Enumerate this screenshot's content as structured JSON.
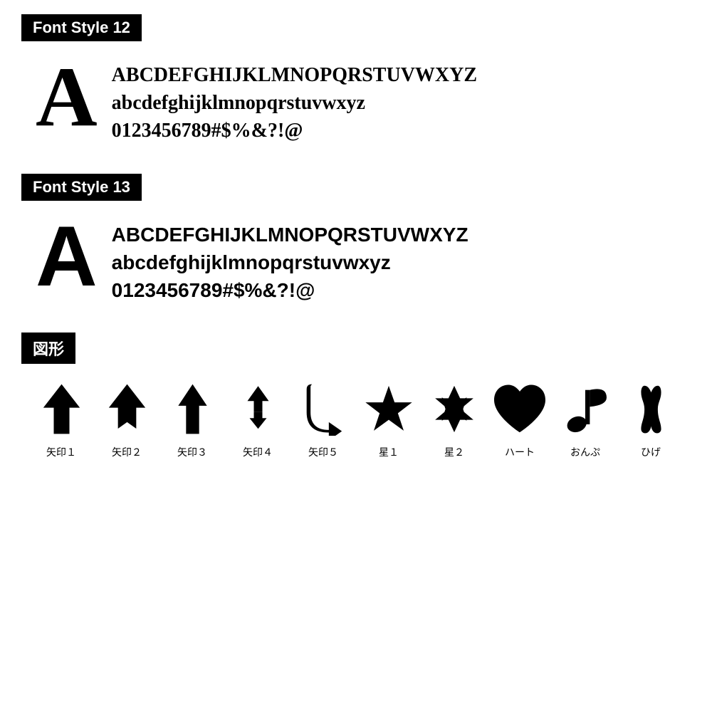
{
  "sections": [
    {
      "id": "font-style-12",
      "label": "Font Style 12",
      "big_letter": "A",
      "lines": [
        "ABCDEFGHIJKLMNOPQRSTUVWXYZ",
        "abcdefghijklmnopqrstuvwxyz",
        "0123456789#$%&?!@"
      ],
      "font_type": "serif"
    },
    {
      "id": "font-style-13",
      "label": "Font Style 13",
      "big_letter": "A",
      "lines": [
        "ABCDEFGHIJKLMNOPQRSTUVWXYZ",
        "abcdefghijklmnopqrstuvwxyz",
        "0123456789#$%&?!@"
      ],
      "font_type": "sans-serif"
    }
  ],
  "shapes_section": {
    "label": "図形",
    "items": [
      {
        "id": "arrow1",
        "label": "矢印１"
      },
      {
        "id": "arrow2",
        "label": "矢印２"
      },
      {
        "id": "arrow3",
        "label": "矢印３"
      },
      {
        "id": "arrow4",
        "label": "矢印４"
      },
      {
        "id": "arrow5",
        "label": "矢印５"
      },
      {
        "id": "star1",
        "label": "星１"
      },
      {
        "id": "star2",
        "label": "星２"
      },
      {
        "id": "heart",
        "label": "ハート"
      },
      {
        "id": "music",
        "label": "おんぷ"
      },
      {
        "id": "moustache",
        "label": "ひげ"
      }
    ]
  }
}
